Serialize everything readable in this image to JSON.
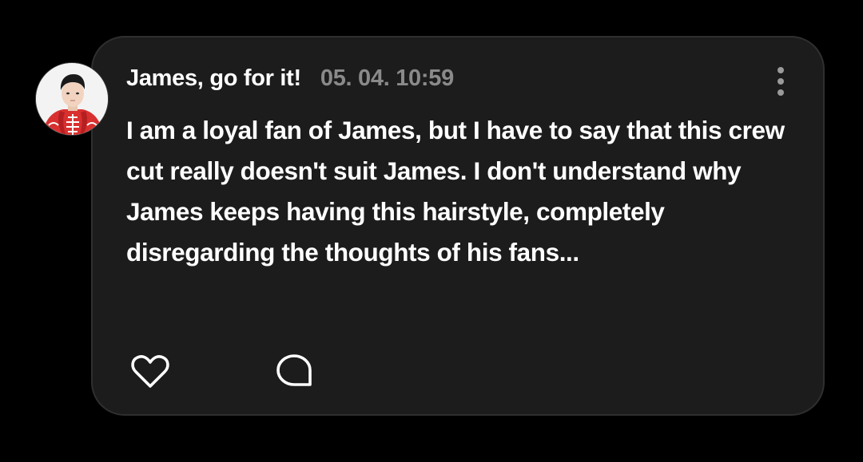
{
  "post": {
    "author": "James, go for it!",
    "timestamp": "05. 04. 10:59",
    "text": "I am a loyal fan of James, but I have to say that this crew cut really doesn't suit James. I don't understand why James keeps having this hairstyle, completely disregarding the thoughts of his fans..."
  },
  "icons": {
    "avatar": "avatar-image",
    "more": "more-vertical-icon",
    "like": "heart-outline-icon",
    "reply": "comment-bubble-icon"
  },
  "colors": {
    "background": "#000000",
    "card": "#1c1c1c",
    "card_border": "#2f2f2f",
    "text": "#ffffff",
    "muted": "#8a8a8a"
  }
}
